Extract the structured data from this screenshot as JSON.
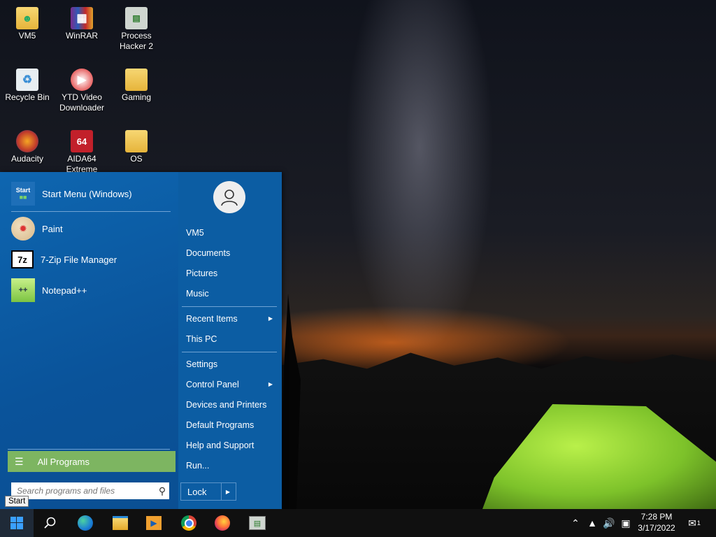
{
  "desktop": {
    "icons": [
      {
        "label": "VM5",
        "icon": "user-folder-icon"
      },
      {
        "label": "WinRAR",
        "icon": "winrar-icon"
      },
      {
        "label": "Process Hacker 2",
        "icon": "process-hacker-icon"
      },
      {
        "label": "Recycle Bin",
        "icon": "recycle-bin-icon"
      },
      {
        "label": "YTD Video Downloader",
        "icon": "ytd-icon"
      },
      {
        "label": "Gaming",
        "icon": "folder-icon"
      },
      {
        "label": "Audacity",
        "icon": "audacity-icon"
      },
      {
        "label": "AIDA64 Extreme",
        "icon": "aida64-icon"
      },
      {
        "label": "OS",
        "icon": "folder-icon"
      }
    ]
  },
  "start_menu": {
    "pinned": [
      {
        "label": "Start Menu (Windows)",
        "icon": "start-menu-settings-icon"
      },
      {
        "label": "Paint",
        "icon": "paint-icon"
      },
      {
        "label": "7-Zip File Manager",
        "icon": "7zip-icon"
      },
      {
        "label": "Notepad++",
        "icon": "notepadpp-icon"
      }
    ],
    "all_programs": "All Programs",
    "search_placeholder": "Search programs and files",
    "right_items": [
      {
        "label": "VM5"
      },
      {
        "label": "Documents"
      },
      {
        "label": "Pictures"
      },
      {
        "label": "Music"
      },
      {
        "label": "Recent Items",
        "has_submenu": true
      },
      {
        "label": "This PC"
      },
      {
        "label": "Settings"
      },
      {
        "label": "Control Panel",
        "has_submenu": true
      },
      {
        "label": "Devices and Printers"
      },
      {
        "label": "Default Programs"
      },
      {
        "label": "Help and Support"
      },
      {
        "label": "Run..."
      }
    ],
    "lock_label": "Lock",
    "start_tooltip": "Start",
    "start_icon_text": "Start"
  },
  "taskbar": {
    "pinned": [
      "windows-start-icon",
      "search-icon",
      "edge-icon",
      "file-explorer-icon",
      "media-player-icon",
      "chrome-icon",
      "firefox-icon",
      "process-hacker-icon"
    ],
    "time": "7:28 PM",
    "date": "3/17/2022",
    "notification_count": "1"
  }
}
